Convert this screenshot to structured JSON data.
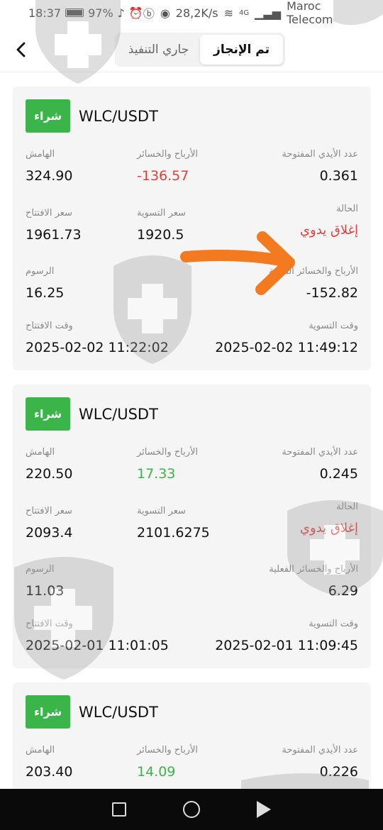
{
  "status_bar": {
    "time": "18:37",
    "battery": "97%",
    "speed": "28,2K/s",
    "network": "4G",
    "carrier": "Maroc Telecom"
  },
  "header": {
    "tabs": [
      {
        "label": "تم الإنجاز",
        "active": true
      },
      {
        "label": "جاري التنفيذ",
        "active": false
      }
    ]
  },
  "labels": {
    "margin": "الهامش",
    "pnl": "الأرباح والخسائر",
    "open_hands": "عدد الأيدي المفتوحة",
    "open_price": "سعر الافتتاح",
    "settle_price": "سعر التسوية",
    "status": "الحالة",
    "fees": "الرسوم",
    "real_pnl": "الأرباح والخسائر الفعلية",
    "open_time": "وقت الافتتاح",
    "settle_time": "وقت التسوية"
  },
  "orders": [
    {
      "side": "شراء",
      "pair": "WLC/USDT",
      "margin": "324.90",
      "pnl": "-136.57",
      "open_hands": "0.361",
      "open_price": "1961.73",
      "settle_price": "1920.5",
      "status": "إغلاق يدوي",
      "fees": "16.25",
      "real_pnl": "-152.82",
      "open_time": "2025-02-02 11:22:02",
      "settle_time": "2025-02-02 11:49:12"
    },
    {
      "side": "شراء",
      "pair": "WLC/USDT",
      "margin": "220.50",
      "pnl": "17.33",
      "open_hands": "0.245",
      "open_price": "2093.4",
      "settle_price": "2101.6275",
      "status": "إغلاق يدوي",
      "fees": "11.03",
      "real_pnl": "6.29",
      "open_time": "2025-02-01 11:01:05",
      "settle_time": "2025-02-01 11:09:45"
    },
    {
      "side": "شراء",
      "pair": "WLC/USDT",
      "margin": "203.40",
      "pnl": "14.09",
      "open_hands": "0.226"
    }
  ],
  "colors": {
    "buy": "#3bb54a",
    "loss": "#e0403a",
    "profit": "#3bb54a",
    "annotation_arrow": "#f47a20"
  }
}
